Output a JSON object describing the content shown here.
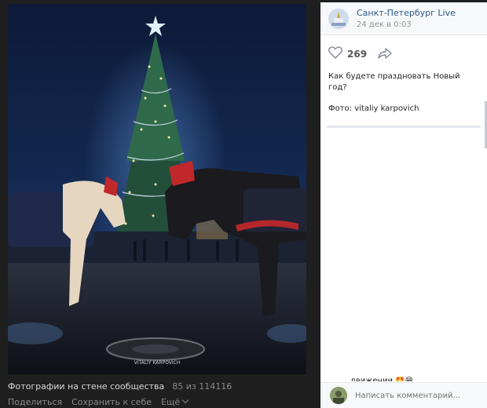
{
  "photo": {
    "watermark": "VITALIY KARPOVICH"
  },
  "footer": {
    "album_label": "Фотографии на стене сообщества",
    "counter": "85 из 114116",
    "share_label": "Поделиться",
    "save_label": "Сохранить к себе",
    "more_label": "Ещё"
  },
  "post": {
    "author": "Санкт-Петербург Live",
    "date": "24 дек в 0:03",
    "likes": "269",
    "text": "Как будете праздновать Новый год?",
    "credit": "Фото: vitaliy karpovich"
  },
  "comments": {
    "partial_text": "движении 🤩😁",
    "placeholder": "Написать комментарий..."
  },
  "colors": {
    "accent": "#2a5885",
    "sidebar_bg": "#ffffff",
    "viewer_bg": "#1f1f1f"
  }
}
